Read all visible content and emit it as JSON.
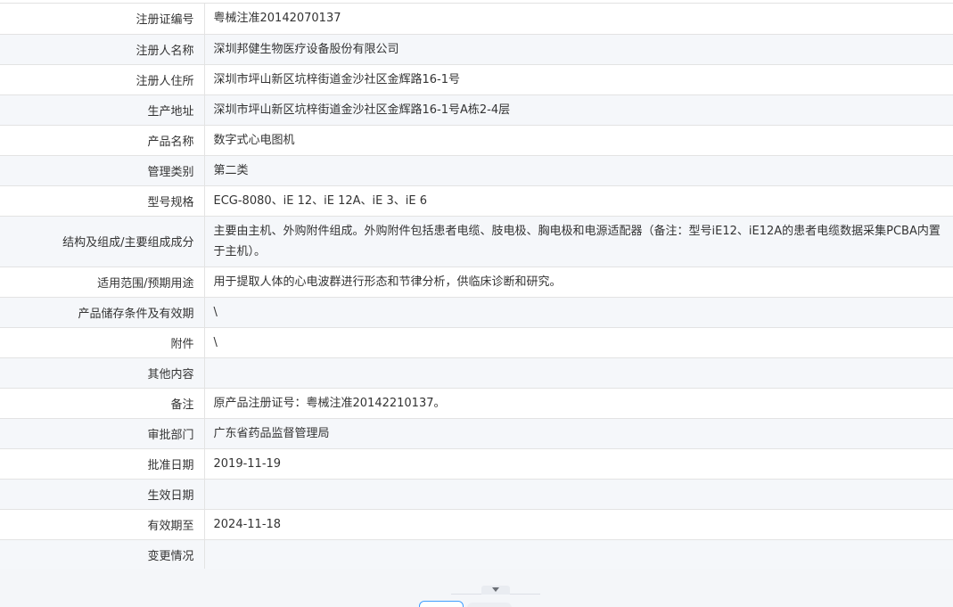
{
  "rows": [
    {
      "label": "注册证编号",
      "value": "粤械注准20142070137"
    },
    {
      "label": "注册人名称",
      "value": "深圳邦健生物医疗设备股份有限公司"
    },
    {
      "label": "注册人住所",
      "value": "深圳市坪山新区坑梓街道金沙社区金辉路16-1号"
    },
    {
      "label": "生产地址",
      "value": "深圳市坪山新区坑梓街道金沙社区金辉路16-1号A栋2-4层"
    },
    {
      "label": "产品名称",
      "value": "数字式心电图机"
    },
    {
      "label": "管理类别",
      "value": "第二类"
    },
    {
      "label": "型号规格",
      "value": "ECG-8080、iE 12、iE 12A、iE 3、iE 6"
    },
    {
      "label": "结构及组成/主要组成成分",
      "value": "主要由主机、外购附件组成。外购附件包括患者电缆、肢电极、胸电极和电源适配器（备注：型号iE12、iE12A的患者电缆数据采集PCBA内置于主机）。"
    },
    {
      "label": "适用范围/预期用途",
      "value": "用于提取人体的心电波群进行形态和节律分析，供临床诊断和研究。"
    },
    {
      "label": "产品储存条件及有效期",
      "value": "\\"
    },
    {
      "label": "附件",
      "value": "\\"
    },
    {
      "label": "其他内容",
      "value": ""
    },
    {
      "label": "备注",
      "value": "原产品注册证号：粤械注准20142210137。"
    },
    {
      "label": "审批部门",
      "value": "广东省药品监督管理局"
    },
    {
      "label": "批准日期",
      "value": "2019-11-19"
    },
    {
      "label": "生效日期",
      "value": ""
    },
    {
      "label": "有效期至",
      "value": "2024-11-18"
    },
    {
      "label": "变更情况",
      "value": ""
    }
  ],
  "icons": {
    "collapse": "caret-down-icon"
  },
  "colors": {
    "row_alt_bg": "#f5f7fa",
    "border": "#e3e3e3",
    "text": "#333333",
    "accent": "#409eff"
  }
}
